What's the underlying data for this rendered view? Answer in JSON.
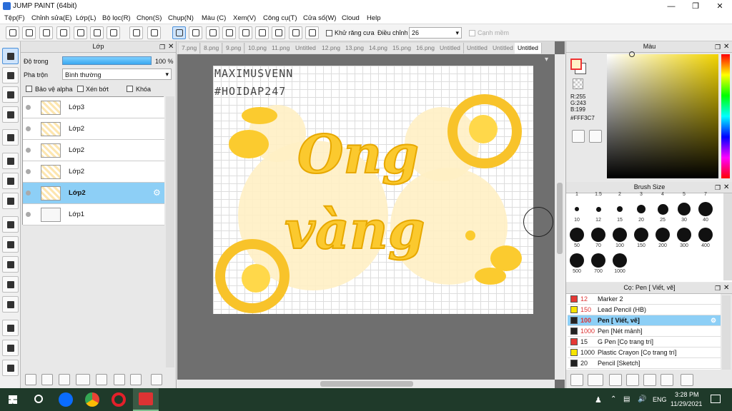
{
  "window": {
    "title": "JUMP PAINT (64bit)"
  },
  "menu": [
    "Tệp(F)",
    "Chỉnh sửa(E)",
    "Lớp(L)",
    "Bộ lọc(R)",
    "Chọn(S)",
    "Chụp(N)",
    "Màu (C)",
    "Xem(V)",
    "Công cụ(T)",
    "Cửa số(W)",
    "Cloud",
    "Help"
  ],
  "toolbar": {
    "antialias_label": "Khử răng cưa",
    "adjust_label": "Điều chỉnh",
    "adjust_value": "26",
    "smooth_label": "Cạnh mềm"
  },
  "layer_panel": {
    "title": "Lớp",
    "opacity_label": "Độ trong",
    "opacity_value": "100 %",
    "blend_label": "Pha trộn",
    "blend_value": "Bình thường",
    "protect_alpha": "Bảo vệ alpha",
    "clip": "Xén bớt",
    "lock": "Khóa",
    "layers": [
      {
        "name": "Lớp3"
      },
      {
        "name": "Lớp2"
      },
      {
        "name": "Lớp2"
      },
      {
        "name": "Lớp2"
      },
      {
        "name": "Lớp2"
      },
      {
        "name": "Lớp1"
      }
    ]
  },
  "tabs": [
    "7.png",
    "8.png",
    "9.png",
    "10.png",
    "11.png",
    "Untitled",
    "12.png",
    "13.png",
    "14.png",
    "15.png",
    "16.png",
    "Untitled",
    "Untitled",
    "Untitled",
    "Untitled"
  ],
  "canvas": {
    "watermark1": "MAXIMUSVENN",
    "watermark2": "#HOIDAP247",
    "text_line1": "Ong",
    "text_line2": "vàng"
  },
  "color_panel": {
    "title": "Màu",
    "r": "R:255",
    "g": "G:243",
    "b": "B:199",
    "hex": "#FFF3C7"
  },
  "brush_size": {
    "title": "Brush Size",
    "top_labels": [
      "1",
      "1.5",
      "2",
      "3",
      "4",
      "5",
      "7"
    ],
    "rows": [
      [
        {
          "v": "10",
          "d": 6
        },
        {
          "v": "12",
          "d": 7
        },
        {
          "v": "15",
          "d": 8
        },
        {
          "v": "20",
          "d": 12
        },
        {
          "v": "25",
          "d": 15
        },
        {
          "v": "30",
          "d": 18
        },
        {
          "v": "40",
          "d": 20
        }
      ],
      [
        {
          "v": "50",
          "d": 20
        },
        {
          "v": "70",
          "d": 20
        },
        {
          "v": "100",
          "d": 20
        },
        {
          "v": "150",
          "d": 20
        },
        {
          "v": "200",
          "d": 20
        },
        {
          "v": "300",
          "d": 20
        },
        {
          "v": "400",
          "d": 20
        }
      ],
      [
        {
          "v": "500",
          "d": 20
        },
        {
          "v": "700",
          "d": 20
        },
        {
          "v": "1000",
          "d": 20
        }
      ]
    ]
  },
  "brush_set": {
    "title": "Cọ: Pen [ Viết, vẽ]",
    "items": [
      {
        "size": "12",
        "name": "Marker 2",
        "color": "#e53935",
        "red": true
      },
      {
        "size": "150",
        "name": "Lead Pencil (HB)",
        "color": "#f7e400",
        "red": true
      },
      {
        "size": "100",
        "name": "Pen [ Viết, vẽ]",
        "color": "#222222",
        "red": true,
        "sel": true
      },
      {
        "size": "1000",
        "name": "Pen [Nét mảnh]",
        "color": "#222222",
        "red": true
      },
      {
        "size": "15",
        "name": "G Pen [Cọ trang trí]",
        "color": "#e53935",
        "red": false
      },
      {
        "size": "1000",
        "name": "Plastic Crayon [Cọ trang trí]",
        "color": "#f7e400",
        "red": false
      },
      {
        "size": "20",
        "name": "Pencil [Sketch]",
        "color": "#222222",
        "red": false
      }
    ]
  },
  "taskbar": {
    "time": "3:28 PM",
    "date": "11/29/2021",
    "lang": "ENG"
  }
}
